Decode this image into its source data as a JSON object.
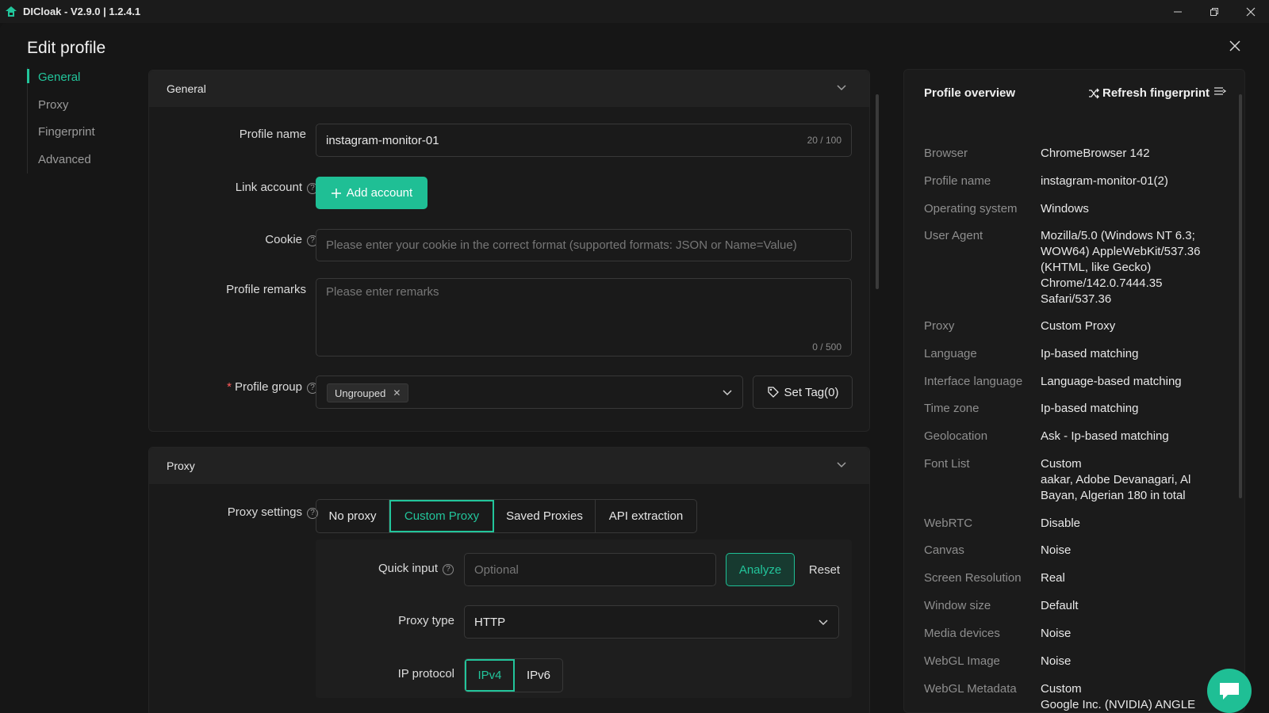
{
  "window": {
    "title": "DICloak - V2.9.0 | 1.2.4.1",
    "brand_color": "#22c59b"
  },
  "page": {
    "title": "Edit profile"
  },
  "nav": {
    "items": [
      {
        "label": "General",
        "active": true
      },
      {
        "label": "Proxy",
        "active": false
      },
      {
        "label": "Fingerprint",
        "active": false
      },
      {
        "label": "Advanced",
        "active": false
      }
    ]
  },
  "general": {
    "header": "General",
    "profile_name_label": "Profile name",
    "profile_name_value": "instagram-monitor-01",
    "profile_name_counter": "20 / 100",
    "link_account_label": "Link account",
    "add_account_label": "Add account",
    "cookie_label": "Cookie",
    "cookie_placeholder": "Please enter your cookie in the correct format (supported formats: JSON or Name=Value)",
    "remarks_label": "Profile remarks",
    "remarks_placeholder": "Please enter remarks",
    "remarks_counter": "0 / 500",
    "group_label": "Profile group",
    "group_required": "*",
    "group_tag": "Ungrouped",
    "set_tag_label": "Set Tag(0)"
  },
  "proxy": {
    "header": "Proxy",
    "settings_label": "Proxy settings",
    "modes": [
      "No proxy",
      "Custom Proxy",
      "Saved Proxies",
      "API extraction"
    ],
    "active_mode": "Custom Proxy",
    "quick_input_label": "Quick input",
    "quick_input_placeholder": "Optional",
    "analyze_label": "Analyze",
    "reset_label": "Reset",
    "proxy_type_label": "Proxy type",
    "proxy_type_value": "HTTP",
    "ip_protocol_label": "IP protocol",
    "ip_protocols": [
      "IPv4",
      "IPv6"
    ],
    "active_ip_protocol": "IPv4"
  },
  "overview": {
    "title": "Profile overview",
    "refresh_label": "Refresh fingerprint",
    "rows": [
      {
        "key": "Browser",
        "value": "ChromeBrowser 142"
      },
      {
        "key": "Profile name",
        "value": "instagram-monitor-01(2)"
      },
      {
        "key": "Operating system",
        "value": "Windows"
      },
      {
        "key": "User Agent",
        "value": "Mozilla/5.0 (Windows NT 6.3;\nWOW64) AppleWebKit/537.36\n(KHTML, like Gecko)\nChrome/142.0.7444.35\nSafari/537.36"
      },
      {
        "key": "Proxy",
        "value": "Custom Proxy"
      },
      {
        "key": "Language",
        "value": "Ip-based matching"
      },
      {
        "key": "Interface language",
        "value": "Language-based matching"
      },
      {
        "key": "Time zone",
        "value": "Ip-based matching"
      },
      {
        "key": "Geolocation",
        "value": "Ask - Ip-based matching"
      },
      {
        "key": "Font List",
        "value": "Custom\naakar, Adobe Devanagari, Al\nBayan, Algerian 180 in total"
      },
      {
        "key": "WebRTC",
        "value": "Disable"
      },
      {
        "key": "Canvas",
        "value": "Noise"
      },
      {
        "key": "Screen Resolution",
        "value": "Real"
      },
      {
        "key": "Window size",
        "value": "Default"
      },
      {
        "key": "Media devices",
        "value": "Noise"
      },
      {
        "key": "WebGL Image",
        "value": "Noise"
      },
      {
        "key": "WebGL Metadata",
        "value": "Custom\nGoogle Inc. (NVIDIA) ANGLE\n(NVIDIA, NVIDIA GeForce GTX"
      }
    ]
  }
}
